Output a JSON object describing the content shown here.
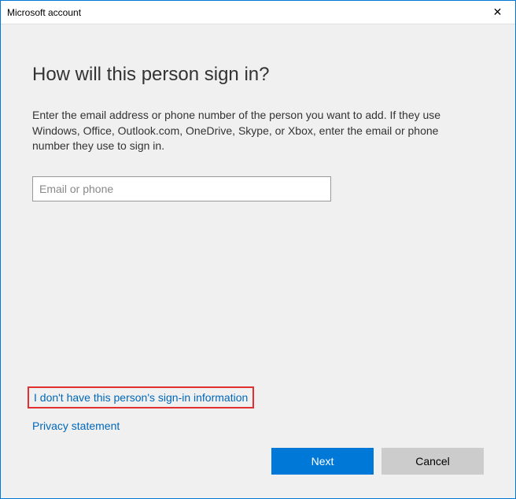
{
  "titlebar": {
    "title": "Microsoft account",
    "close_glyph": "✕"
  },
  "main": {
    "heading": "How will this person sign in?",
    "description": "Enter the email address or phone number of the person you want to add. If they use Windows, Office, Outlook.com, OneDrive, Skype, or Xbox, enter the email or phone number they use to sign in.",
    "input_placeholder": "Email or phone",
    "input_value": ""
  },
  "links": {
    "no_info": "I don't have this person's sign-in information",
    "privacy": "Privacy statement"
  },
  "buttons": {
    "next": "Next",
    "cancel": "Cancel"
  }
}
